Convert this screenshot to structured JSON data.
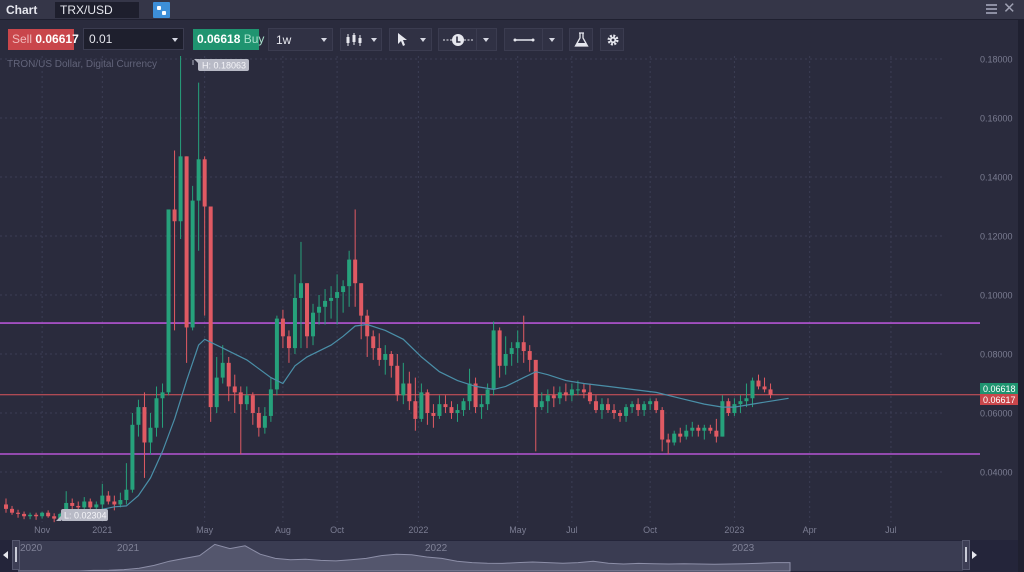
{
  "window": {
    "title": "Chart",
    "symbol": "TRX/USD",
    "link_icon": "link-icon",
    "menu_icon": "hamburger-menu-icon",
    "close_icon": "close-icon",
    "close_glyph": "✕"
  },
  "toolbar": {
    "sell_label": "Sell",
    "sell_price": "0.06617",
    "quantity": "0.01",
    "buy_price": "0.06618",
    "buy_label": "Buy",
    "timeframe": "1w",
    "chart_type_icon": "candlestick-icon",
    "cursor_icon": "cursor-arrow-icon",
    "time_icon": "clock-line-icon",
    "line_icon": "horizontal-line-icon",
    "indicators_icon": "flask-icon",
    "settings_icon": "gear-icon"
  },
  "chart": {
    "description": "TRON/US Dollar, Digital Currency",
    "high_label": "H: 0.18063",
    "low_label": "L: 0.02304",
    "ask_tag": "0.06618",
    "bid_tag": "0.06617",
    "colors": {
      "up": "#26a17b",
      "down": "#e05a63",
      "ma": "#4a8fa8",
      "support_resistance": "#b455d4",
      "price_line": "#d9545c",
      "grid": "#3c3e55",
      "axis_text": "#7b7d92"
    }
  },
  "navigator": {
    "labels": [
      "2020",
      "2021",
      "2022",
      "2023"
    ]
  },
  "chart_data": {
    "type": "candlestick",
    "title": "TRX/USD",
    "subtitle": "TRON/US Dollar, Digital Currency",
    "timeframe": "1w",
    "y_ticks": [
      "0.18000",
      "0.16000",
      "0.14000",
      "0.12000",
      "0.10000",
      "0.08000",
      "0.06000",
      "0.04000"
    ],
    "ylim": [
      0.0215,
      0.183
    ],
    "x_ticks": [
      {
        "label": "Nov",
        "week": 6
      },
      {
        "label": "2021",
        "week": 16
      },
      {
        "label": "May",
        "week": 33
      },
      {
        "label": "Aug",
        "week": 46
      },
      {
        "label": "Oct",
        "week": 55
      },
      {
        "label": "2022",
        "week": 68.5
      },
      {
        "label": "May",
        "week": 85
      },
      {
        "label": "Jul",
        "week": 94
      },
      {
        "label": "Oct",
        "week": 107
      },
      {
        "label": "2023",
        "week": 121
      },
      {
        "label": "Apr",
        "week": 133.5
      },
      {
        "label": "Jul",
        "week": 147
      }
    ],
    "horizontal_lines": [
      {
        "name": "resistance",
        "value": 0.0905,
        "color": "#b455d4"
      },
      {
        "name": "support",
        "value": 0.0461,
        "color": "#b455d4"
      },
      {
        "name": "current-price",
        "value": 0.0662,
        "color": "#d9545c"
      }
    ],
    "high": 0.18063,
    "low": 0.02304,
    "bid": 0.06617,
    "ask": 0.06618,
    "candles": [
      [
        0.029,
        0.031,
        0.0262,
        0.0275
      ],
      [
        0.0275,
        0.0285,
        0.0255,
        0.0262
      ],
      [
        0.0262,
        0.0272,
        0.0245,
        0.0258
      ],
      [
        0.0258,
        0.0266,
        0.024,
        0.025
      ],
      [
        0.025,
        0.0262,
        0.024,
        0.0255
      ],
      [
        0.0255,
        0.0262,
        0.0238,
        0.025
      ],
      [
        0.025,
        0.0265,
        0.0242,
        0.0262
      ],
      [
        0.0262,
        0.027,
        0.0245,
        0.025
      ],
      [
        0.025,
        0.026,
        0.023,
        0.0242
      ],
      [
        0.0242,
        0.0262,
        0.0235,
        0.0258
      ],
      [
        0.0258,
        0.0335,
        0.025,
        0.0295
      ],
      [
        0.0295,
        0.031,
        0.027,
        0.0285
      ],
      [
        0.0285,
        0.03,
        0.0265,
        0.028
      ],
      [
        0.028,
        0.0315,
        0.027,
        0.03
      ],
      [
        0.03,
        0.031,
        0.027,
        0.028
      ],
      [
        0.028,
        0.03,
        0.026,
        0.029
      ],
      [
        0.029,
        0.036,
        0.027,
        0.032
      ],
      [
        0.032,
        0.0335,
        0.029,
        0.03
      ],
      [
        0.03,
        0.032,
        0.027,
        0.029
      ],
      [
        0.029,
        0.033,
        0.028,
        0.0305
      ],
      [
        0.0305,
        0.043,
        0.029,
        0.034
      ],
      [
        0.034,
        0.06,
        0.033,
        0.056
      ],
      [
        0.056,
        0.0645,
        0.052,
        0.062
      ],
      [
        0.062,
        0.067,
        0.038,
        0.05
      ],
      [
        0.05,
        0.06,
        0.046,
        0.055
      ],
      [
        0.055,
        0.069,
        0.052,
        0.065
      ],
      [
        0.065,
        0.07,
        0.055,
        0.067
      ],
      [
        0.067,
        0.128,
        0.066,
        0.129
      ],
      [
        0.129,
        0.149,
        0.088,
        0.125
      ],
      [
        0.125,
        0.181,
        0.119,
        0.147
      ],
      [
        0.147,
        0.145,
        0.077,
        0.089
      ],
      [
        0.089,
        0.137,
        0.088,
        0.132
      ],
      [
        0.132,
        0.172,
        0.115,
        0.146
      ],
      [
        0.146,
        0.147,
        0.093,
        0.13
      ],
      [
        0.13,
        0.13,
        0.057,
        0.062
      ],
      [
        0.062,
        0.079,
        0.06,
        0.072
      ],
      [
        0.072,
        0.083,
        0.07,
        0.077
      ],
      [
        0.077,
        0.079,
        0.064,
        0.069
      ],
      [
        0.069,
        0.073,
        0.06,
        0.067
      ],
      [
        0.067,
        0.069,
        0.046,
        0.063
      ],
      [
        0.063,
        0.069,
        0.061,
        0.066
      ],
      [
        0.066,
        0.067,
        0.056,
        0.06
      ],
      [
        0.06,
        0.062,
        0.052,
        0.055
      ],
      [
        0.055,
        0.062,
        0.053,
        0.059
      ],
      [
        0.059,
        0.072,
        0.057,
        0.068
      ],
      [
        0.068,
        0.093,
        0.066,
        0.092
      ],
      [
        0.092,
        0.095,
        0.082,
        0.086
      ],
      [
        0.086,
        0.088,
        0.077,
        0.082
      ],
      [
        0.082,
        0.107,
        0.08,
        0.099
      ],
      [
        0.099,
        0.118,
        0.082,
        0.104
      ],
      [
        0.104,
        0.1,
        0.082,
        0.086
      ],
      [
        0.086,
        0.097,
        0.083,
        0.094
      ],
      [
        0.094,
        0.1,
        0.09,
        0.096
      ],
      [
        0.096,
        0.102,
        0.09,
        0.098
      ],
      [
        0.098,
        0.103,
        0.092,
        0.099
      ],
      [
        0.099,
        0.107,
        0.09,
        0.101
      ],
      [
        0.101,
        0.105,
        0.094,
        0.103
      ],
      [
        0.103,
        0.115,
        0.096,
        0.112
      ],
      [
        0.112,
        0.129,
        0.096,
        0.104
      ],
      [
        0.104,
        0.101,
        0.085,
        0.093
      ],
      [
        0.093,
        0.095,
        0.079,
        0.086
      ],
      [
        0.086,
        0.088,
        0.078,
        0.082
      ],
      [
        0.082,
        0.087,
        0.076,
        0.078
      ],
      [
        0.078,
        0.083,
        0.073,
        0.08
      ],
      [
        0.08,
        0.081,
        0.072,
        0.076
      ],
      [
        0.076,
        0.08,
        0.064,
        0.066
      ],
      [
        0.066,
        0.077,
        0.063,
        0.07
      ],
      [
        0.07,
        0.074,
        0.061,
        0.064
      ],
      [
        0.064,
        0.072,
        0.054,
        0.058
      ],
      [
        0.058,
        0.07,
        0.057,
        0.067
      ],
      [
        0.067,
        0.068,
        0.056,
        0.06
      ],
      [
        0.06,
        0.063,
        0.055,
        0.059
      ],
      [
        0.059,
        0.066,
        0.058,
        0.063
      ],
      [
        0.063,
        0.066,
        0.06,
        0.062
      ],
      [
        0.062,
        0.064,
        0.058,
        0.06
      ],
      [
        0.06,
        0.063,
        0.057,
        0.061
      ],
      [
        0.061,
        0.065,
        0.059,
        0.064
      ],
      [
        0.064,
        0.075,
        0.061,
        0.07
      ],
      [
        0.07,
        0.072,
        0.06,
        0.062
      ],
      [
        0.062,
        0.066,
        0.058,
        0.063
      ],
      [
        0.063,
        0.07,
        0.061,
        0.068
      ],
      [
        0.068,
        0.091,
        0.066,
        0.088
      ],
      [
        0.088,
        0.089,
        0.072,
        0.076
      ],
      [
        0.076,
        0.086,
        0.073,
        0.08
      ],
      [
        0.08,
        0.084,
        0.076,
        0.082
      ],
      [
        0.082,
        0.088,
        0.077,
        0.084
      ],
      [
        0.084,
        0.093,
        0.077,
        0.081
      ],
      [
        0.081,
        0.083,
        0.074,
        0.078
      ],
      [
        0.078,
        0.075,
        0.047,
        0.062
      ],
      [
        0.062,
        0.067,
        0.061,
        0.064
      ],
      [
        0.064,
        0.068,
        0.06,
        0.066
      ],
      [
        0.066,
        0.069,
        0.062,
        0.065
      ],
      [
        0.065,
        0.069,
        0.063,
        0.067
      ],
      [
        0.067,
        0.07,
        0.064,
        0.066
      ],
      [
        0.066,
        0.07,
        0.064,
        0.068
      ],
      [
        0.068,
        0.071,
        0.066,
        0.068
      ],
      [
        0.068,
        0.07,
        0.065,
        0.067
      ],
      [
        0.067,
        0.07,
        0.063,
        0.064
      ],
      [
        0.064,
        0.066,
        0.06,
        0.061
      ],
      [
        0.061,
        0.065,
        0.058,
        0.063
      ],
      [
        0.063,
        0.065,
        0.06,
        0.061
      ],
      [
        0.061,
        0.063,
        0.058,
        0.06
      ],
      [
        0.06,
        0.061,
        0.057,
        0.059
      ],
      [
        0.059,
        0.063,
        0.057,
        0.062
      ],
      [
        0.062,
        0.064,
        0.06,
        0.063
      ],
      [
        0.063,
        0.065,
        0.059,
        0.061
      ],
      [
        0.061,
        0.064,
        0.059,
        0.063
      ],
      [
        0.063,
        0.065,
        0.061,
        0.064
      ],
      [
        0.064,
        0.065,
        0.06,
        0.061
      ],
      [
        0.061,
        0.062,
        0.047,
        0.051
      ],
      [
        0.051,
        0.053,
        0.046,
        0.05
      ],
      [
        0.05,
        0.054,
        0.049,
        0.053
      ],
      [
        0.053,
        0.055,
        0.05,
        0.052
      ],
      [
        0.052,
        0.056,
        0.051,
        0.054
      ],
      [
        0.054,
        0.057,
        0.052,
        0.055
      ],
      [
        0.055,
        0.056,
        0.052,
        0.054
      ],
      [
        0.054,
        0.056,
        0.051,
        0.055
      ],
      [
        0.055,
        0.056,
        0.053,
        0.054
      ],
      [
        0.054,
        0.058,
        0.05,
        0.052
      ],
      [
        0.052,
        0.066,
        0.052,
        0.064
      ],
      [
        0.064,
        0.065,
        0.059,
        0.06
      ],
      [
        0.06,
        0.065,
        0.059,
        0.063
      ],
      [
        0.063,
        0.066,
        0.06,
        0.064
      ],
      [
        0.064,
        0.07,
        0.062,
        0.065
      ],
      [
        0.065,
        0.072,
        0.062,
        0.071
      ],
      [
        0.071,
        0.073,
        0.068,
        0.069
      ],
      [
        0.069,
        0.072,
        0.067,
        0.068
      ],
      [
        0.068,
        0.07,
        0.065,
        0.0662
      ]
    ],
    "ma_line": [
      [
        10,
        0.0245
      ],
      [
        14,
        0.0265
      ],
      [
        18,
        0.0282
      ],
      [
        20,
        0.0285
      ],
      [
        22,
        0.032
      ],
      [
        24,
        0.038
      ],
      [
        26,
        0.047
      ],
      [
        28,
        0.058
      ],
      [
        30,
        0.071
      ],
      [
        32,
        0.083
      ],
      [
        33,
        0.085
      ],
      [
        36,
        0.082
      ],
      [
        40,
        0.078
      ],
      [
        44,
        0.072
      ],
      [
        46,
        0.07
      ],
      [
        48,
        0.076
      ],
      [
        50,
        0.079
      ],
      [
        54,
        0.083
      ],
      [
        56,
        0.086
      ],
      [
        58,
        0.0895
      ],
      [
        60,
        0.09
      ],
      [
        63,
        0.088
      ],
      [
        66,
        0.085
      ],
      [
        69,
        0.079
      ],
      [
        72,
        0.074
      ],
      [
        75,
        0.071
      ],
      [
        78,
        0.069
      ],
      [
        81,
        0.068
      ],
      [
        83,
        0.069
      ],
      [
        86,
        0.072
      ],
      [
        88,
        0.074
      ],
      [
        90,
        0.073
      ],
      [
        93,
        0.071
      ],
      [
        96,
        0.07
      ],
      [
        100,
        0.069
      ],
      [
        104,
        0.068
      ],
      [
        108,
        0.067
      ],
      [
        112,
        0.065
      ],
      [
        116,
        0.063
      ],
      [
        119,
        0.062
      ],
      [
        121,
        0.062
      ],
      [
        124,
        0.063
      ],
      [
        127,
        0.064
      ],
      [
        130,
        0.065
      ]
    ],
    "navigator_volume": [
      0,
      0,
      0,
      0,
      0,
      0.02,
      0.03,
      0.05,
      0.1,
      0.2,
      0.35,
      0.45,
      0.55,
      0.95,
      0.8,
      0.9,
      0.6,
      0.45,
      0.4,
      0.42,
      0.38,
      0.36,
      0.4,
      0.45,
      0.55,
      0.6,
      0.58,
      0.5,
      0.45,
      0.35,
      0.3,
      0.28,
      0.27,
      0.3,
      0.32,
      0.3,
      0.28,
      0.3,
      0.35,
      0.28,
      0.25,
      0.27,
      0.26,
      0.25,
      0.26,
      0.25,
      0.24,
      0.25,
      0.26,
      0.28,
      0.3,
      0.3
    ]
  }
}
